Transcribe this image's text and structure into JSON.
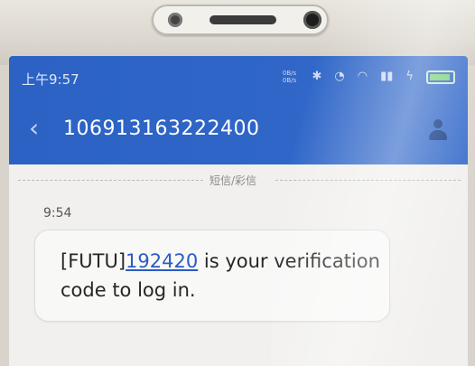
{
  "status_bar": {
    "time": "上午9:57",
    "net_speed_top": "0B/s",
    "net_speed_bottom": "0B/s"
  },
  "header": {
    "back_icon": "chevron-left-icon",
    "sender_number": "106913163222400",
    "contact_icon": "contact-person-icon"
  },
  "thread": {
    "divider_label": "短信/彩信",
    "message_time": "9:54",
    "message": {
      "prefix": "[FUTU]",
      "code": "192420",
      "suffix": " is your verification code to log in."
    }
  },
  "colors": {
    "header": "#2f66c8",
    "link": "#2b5bc4",
    "bubble": "#f8f8f7"
  }
}
